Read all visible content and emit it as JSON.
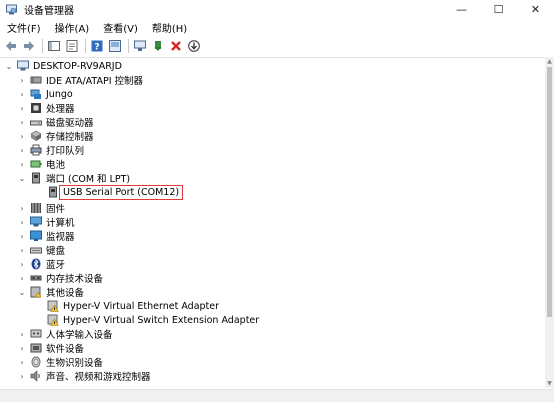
{
  "window": {
    "title": "设备管理器",
    "minimize": "—",
    "maximize": "☐",
    "close": "✕"
  },
  "menu": [
    "文件(F)",
    "操作(A)",
    "查看(V)",
    "帮助(H)"
  ],
  "tree": {
    "root": "DESKTOP-RV9ARJD",
    "items": [
      "IDE ATA/ATAPI 控制器",
      "Jungo",
      "处理器",
      "磁盘驱动器",
      "存储控制器",
      "打印队列",
      "电池",
      "端口 (COM 和 LPT)",
      "USB Serial Port (COM12)",
      "固件",
      "计算机",
      "监视器",
      "键盘",
      "蓝牙",
      "内存技术设备",
      "其他设备",
      "Hyper-V Virtual Ethernet Adapter",
      "Hyper-V Virtual Switch Extension Adapter",
      "人体学输入设备",
      "软件设备",
      "生物识别设备",
      "声音、视频和游戏控制器"
    ]
  },
  "chevrons": {
    "expanded": "⌄",
    "collapsed": "›"
  },
  "colors": {
    "selection_border": "#e33b3b",
    "accent_blue": "#2f6ebd",
    "warning_yellow": "#f2c230",
    "delete_red": "#d92626"
  }
}
